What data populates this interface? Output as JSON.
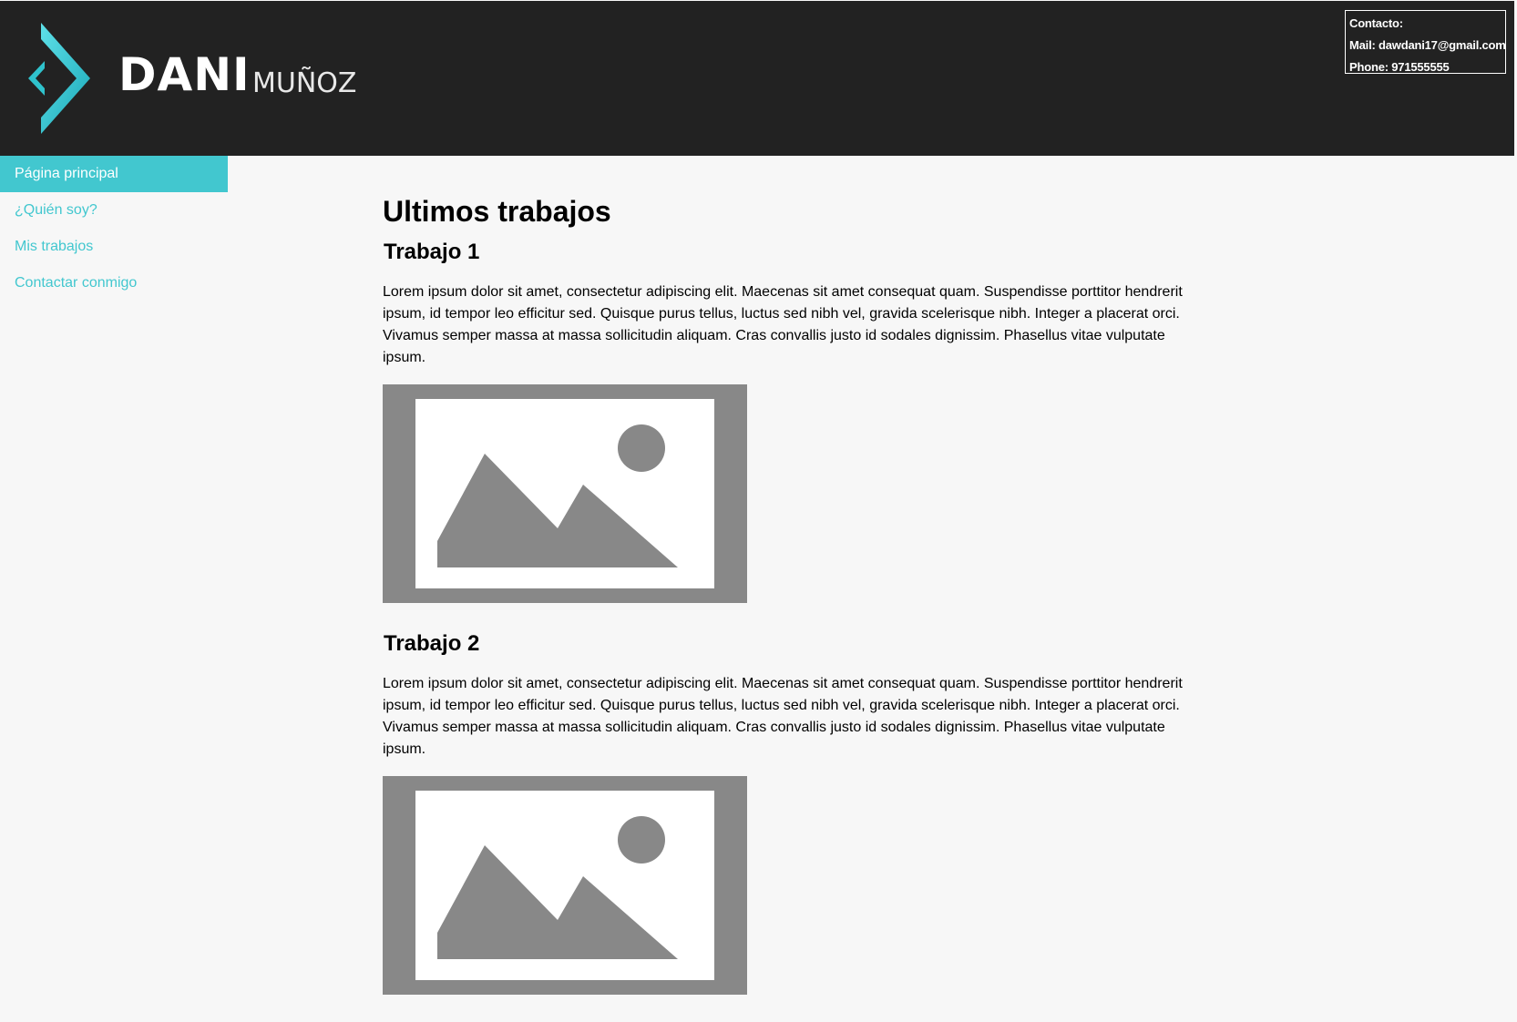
{
  "header": {
    "logo": {
      "main": "DANI",
      "sub": "MUÑOZ"
    },
    "contact": {
      "title": "Contacto:",
      "mail": "Mail: dawdani17@gmail.com",
      "phone": "Phone: 971555555"
    }
  },
  "nav": {
    "items": [
      {
        "label": "Página principal",
        "active": true
      },
      {
        "label": "¿Quién soy?",
        "active": false
      },
      {
        "label": "Mis trabajos",
        "active": false
      },
      {
        "label": "Contactar conmigo",
        "active": false
      }
    ]
  },
  "main": {
    "title": "Ultimos trabajos",
    "works": [
      {
        "title": "Trabajo 1",
        "text": "Lorem ipsum dolor sit amet, consectetur adipiscing elit. Maecenas sit amet consequat quam. Suspendisse porttitor hendrerit ipsum, id tempor leo efficitur sed. Quisque purus tellus, luctus sed nibh vel, gravida scelerisque nibh. Integer a placerat orci. Vivamus semper massa at massa sollicitudin aliquam. Cras convallis justo id sodales dignissim. Phasellus vitae vulputate ipsum."
      },
      {
        "title": "Trabajo 2",
        "text": "Lorem ipsum dolor sit amet, consectetur adipiscing elit. Maecenas sit amet consequat quam. Suspendisse porttitor hendrerit ipsum, id tempor leo efficitur sed. Quisque purus tellus, luctus sed nibh vel, gravida scelerisque nibh. Integer a placerat orci. Vivamus semper massa at massa sollicitudin aliquam. Cras convallis justo id sodales dignissim. Phasellus vitae vulputate ipsum."
      }
    ]
  },
  "colors": {
    "header_bg": "#222222",
    "accent": "#42c7cf",
    "page_bg": "#f7f7f7",
    "placeholder_gray": "#888888"
  },
  "icons": [
    "logo-chevron-icon",
    "image-placeholder-icon"
  ]
}
